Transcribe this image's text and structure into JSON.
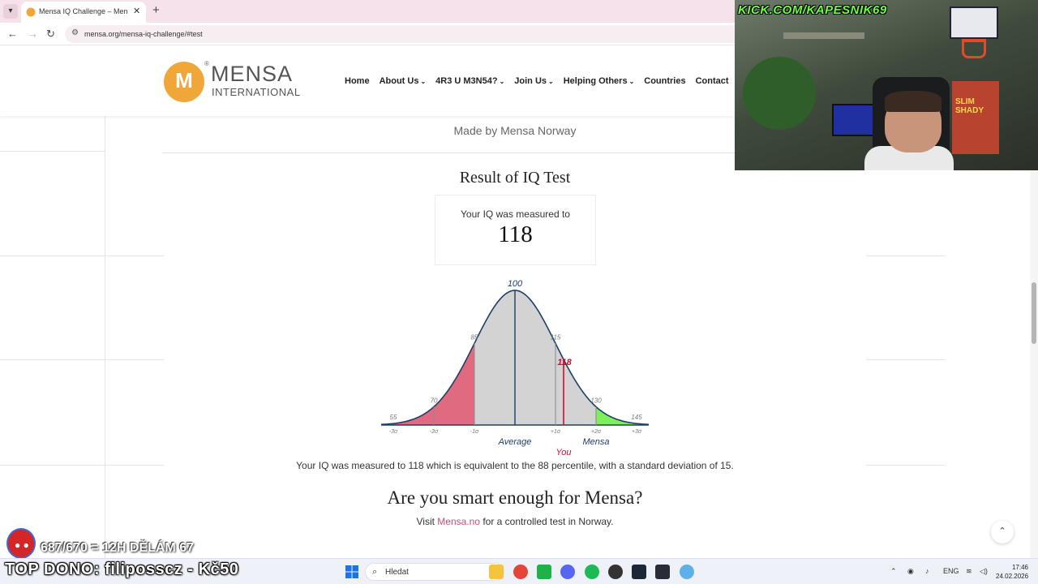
{
  "browser": {
    "tab_title": "Mensa IQ Challenge – Mensa In",
    "tab_close": "✕",
    "new_tab": "+",
    "url": "mensa.org/mensa-iq-challenge/#test"
  },
  "header": {
    "logo_name": "MENSA",
    "logo_sub": "INTERNATIONAL",
    "logo_mark": "M",
    "menu": [
      {
        "label": "Home"
      },
      {
        "label": "About Us",
        "caret": "⌄"
      },
      {
        "label": "4R3 U M3N54?",
        "caret": "⌄"
      },
      {
        "label": "Join Us",
        "caret": "⌄"
      },
      {
        "label": "Helping Others",
        "caret": "⌄"
      },
      {
        "label": "Countries"
      },
      {
        "label": "Contact"
      }
    ]
  },
  "main": {
    "made_by": "Made by Mensa Norway",
    "result_title": "Result of IQ Test",
    "iq_label": "Your IQ was measured to",
    "iq_value": "118",
    "summary": "Your IQ was measured to 118 which is equivalent to the 88 percentile, with a standard deviation of 15.",
    "cta_title": "Are you smart enough for Mensa?",
    "visit_prefix": "Visit ",
    "visit_link": "Mensa.no",
    "visit_suffix": " for a controlled test in Norway.",
    "to_top": "⌃"
  },
  "chart_data": {
    "type": "area",
    "distribution": "normal",
    "mean": 100,
    "sd": 15,
    "score": 118,
    "iq_labels": [
      {
        "iq": 55,
        "text": "55"
      },
      {
        "iq": 70,
        "text": "70"
      },
      {
        "iq": 85,
        "text": "85"
      },
      {
        "iq": 100,
        "text": "100"
      },
      {
        "iq": 115,
        "text": "115"
      },
      {
        "iq": 130,
        "text": "130"
      },
      {
        "iq": 145,
        "text": "145"
      }
    ],
    "sigma_labels": [
      "-3σ",
      "-2σ",
      "-1σ",
      "+1σ",
      "+2σ",
      "+3σ"
    ],
    "sigma_values": [
      55,
      70,
      85,
      115,
      130,
      145
    ],
    "score_label": "118",
    "average_label": "Average",
    "you_label": "You",
    "mensa_label": "Mensa",
    "colors": {
      "low": "#e06b80",
      "mid": "#d3d3d3",
      "mensa": "#7df05a",
      "line": "#1d3e66",
      "you": "#c8102e"
    }
  },
  "stream": {
    "kick_banner": "KICK.COM/KAPESNIK69",
    "poster_text": "SLIM SHADY",
    "goal": "687/670 = 12H DĚLÁM 67",
    "top_dono": "TOP DONO: filiposscz - Kč50"
  },
  "taskbar": {
    "search_placeholder": "Hledat",
    "lang": "ENG",
    "time": "17:46",
    "date": "24.02.2026"
  }
}
